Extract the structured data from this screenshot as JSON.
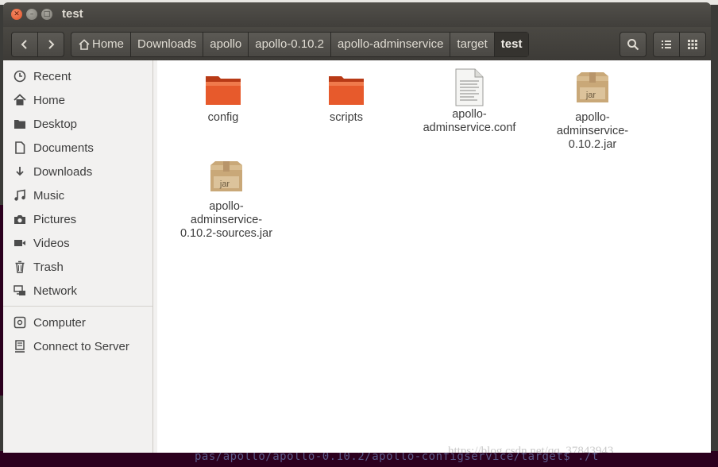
{
  "window": {
    "title": "test",
    "controls": [
      "close-icon",
      "minimize-icon",
      "maximize-icon"
    ]
  },
  "toolbar": {
    "back_icon": "chevron-left-icon",
    "forward_icon": "chevron-right-icon",
    "breadcrumbs": [
      "Home",
      "Downloads",
      "apollo",
      "apollo-0.10.2",
      "apollo-adminservice",
      "target",
      "test"
    ],
    "active_crumb": "test",
    "search_icon": "search-icon",
    "list_view_icon": "list-view-icon",
    "grid_view_icon": "grid-view-icon"
  },
  "sidebar": {
    "items": [
      {
        "label": "Recent",
        "icon": "clock-icon"
      },
      {
        "label": "Home",
        "icon": "home-icon"
      },
      {
        "label": "Desktop",
        "icon": "folder-icon"
      },
      {
        "label": "Documents",
        "icon": "document-icon"
      },
      {
        "label": "Downloads",
        "icon": "download-icon"
      },
      {
        "label": "Music",
        "icon": "music-icon"
      },
      {
        "label": "Pictures",
        "icon": "camera-icon"
      },
      {
        "label": "Videos",
        "icon": "video-icon"
      },
      {
        "label": "Trash",
        "icon": "trash-icon"
      },
      {
        "label": "Network",
        "icon": "network-icon"
      },
      {
        "label": "Computer",
        "icon": "computer-icon"
      },
      {
        "label": "Connect to Server",
        "icon": "server-icon"
      }
    ]
  },
  "files": [
    {
      "name": "config",
      "type": "folder"
    },
    {
      "name": "scripts",
      "type": "folder"
    },
    {
      "name": "apollo-adminservice.conf",
      "type": "text"
    },
    {
      "name": "apollo-adminservice-0.10.2.jar",
      "type": "jar",
      "badge": "jar"
    },
    {
      "name": "apollo-adminservice-0.10.2-sources.jar",
      "type": "jar",
      "badge": "jar"
    }
  ],
  "background": {
    "terminal_text": "pas/apollo/apollo-0.10.2/apollo-configservice/target$ ./t"
  },
  "watermark": "https://blog.csdn.net/qq_37843943",
  "colors": {
    "titlebar": "#45433f",
    "folder_orange": "#e4572e",
    "close_button": "#e95420",
    "content_bg": "#ffffff"
  }
}
